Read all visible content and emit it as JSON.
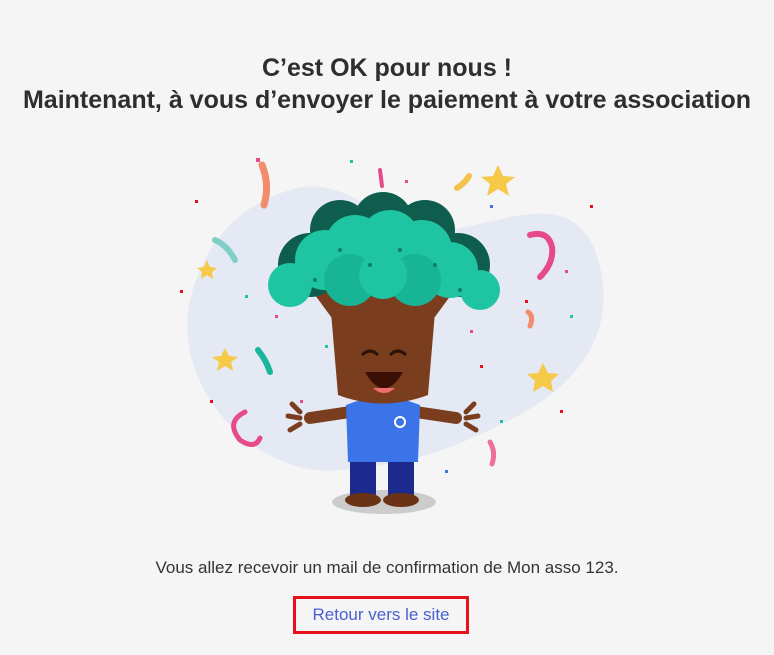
{
  "header": {
    "title_line1": "C’est OK pour nous !",
    "title_line2": "Maintenant, à vous d’envoyer le paiement à votre association"
  },
  "illustration": {
    "icon": "tree-mascot-celebration"
  },
  "confirmation": {
    "text": "Vous allez recevoir un mail de confirmation de Mon asso 123."
  },
  "actions": {
    "back_link_label": "Retour vers le site"
  },
  "colors": {
    "link": "#4a5fd1",
    "highlight_border": "#e8101a",
    "blob": "#e4e9f4",
    "foliage": "#1fc4a3",
    "trunk": "#7a3e1e",
    "shirt": "#3b73e8"
  }
}
